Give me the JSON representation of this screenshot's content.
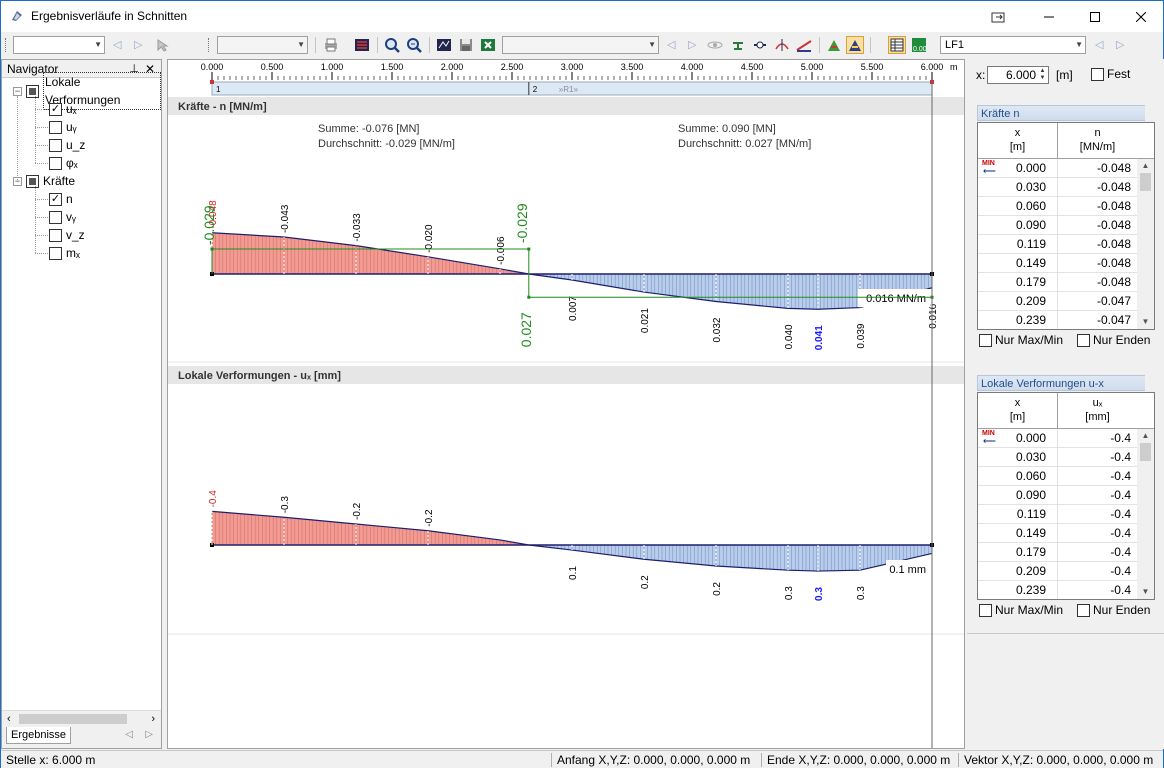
{
  "window": {
    "title": "Ergebnisverläufe in Schnitten"
  },
  "toolbar": {
    "load_case": "LF1"
  },
  "navigator": {
    "title": "Navigator",
    "tab_label": "Ergebnisse",
    "groups": [
      {
        "label": "Lokale Verformungen",
        "items": [
          {
            "label": "uₓ",
            "checked": true
          },
          {
            "label": "uᵧ",
            "checked": false
          },
          {
            "label": "u_z",
            "checked": false
          },
          {
            "label": "φₓ",
            "checked": false
          }
        ]
      },
      {
        "label": "Kräfte",
        "items": [
          {
            "label": "n",
            "checked": true
          },
          {
            "label": "vᵧ",
            "checked": false
          },
          {
            "label": "v_z",
            "checked": false
          },
          {
            "label": "mₓ",
            "checked": false
          }
        ]
      }
    ]
  },
  "ruler": {
    "ticks": [
      "0.000",
      "0.500",
      "1.000",
      "1.500",
      "2.000",
      "2.500",
      "3.000",
      "3.500",
      "4.000",
      "4.500",
      "5.000",
      "5.500",
      "6.000"
    ],
    "unit": "m",
    "segment_labels": [
      "1",
      "2"
    ],
    "segment_name": "»R1»"
  },
  "chart_data": [
    {
      "type": "area",
      "title": "Kräfte - n [MN/m]",
      "x_unit": "m",
      "xlim": [
        0,
        6.0
      ],
      "summary": [
        {
          "sum": "Summe: -0.076 [MN]",
          "avg": "Durchschnitt: -0.029 [MN/m]"
        },
        {
          "sum": "Summe: 0.090 [MN]",
          "avg": "Durchschnitt: 0.027 [MN/m]"
        }
      ],
      "x": [
        0.0,
        0.6,
        1.2,
        1.8,
        2.4,
        2.64,
        3.0,
        3.6,
        4.2,
        4.8,
        5.05,
        5.4,
        6.0
      ],
      "y": [
        -0.048,
        -0.043,
        -0.033,
        -0.02,
        -0.006,
        0.0,
        0.007,
        0.021,
        0.032,
        0.04,
        0.041,
        0.039,
        0.016
      ],
      "point_labels": [
        {
          "x": 0.0,
          "text": "-0.048",
          "color": "#d42020"
        },
        {
          "x": 0.6,
          "text": "-0.043",
          "color": "#000000"
        },
        {
          "x": 1.2,
          "text": "-0.033",
          "color": "#000000"
        },
        {
          "x": 1.8,
          "text": "-0.020",
          "color": "#000000"
        },
        {
          "x": 2.4,
          "text": "-0.006",
          "color": "#000000"
        },
        {
          "x": 3.0,
          "text": "0.007",
          "color": "#000000"
        },
        {
          "x": 3.6,
          "text": "0.021",
          "color": "#000000"
        },
        {
          "x": 4.2,
          "text": "0.032",
          "color": "#000000"
        },
        {
          "x": 4.8,
          "text": "0.040",
          "color": "#000000"
        },
        {
          "x": 5.05,
          "text": "0.041",
          "color": "#1a1aff"
        },
        {
          "x": 5.4,
          "text": "0.039",
          "color": "#000000"
        },
        {
          "x": 6.0,
          "text": "0.016",
          "color": "#000000"
        }
      ],
      "averages": [
        {
          "x_from": 0.0,
          "x_to": 2.64,
          "value": -0.029,
          "text": "-0.029"
        },
        {
          "x_from": 2.64,
          "x_to": 6.0,
          "value": 0.027,
          "text": "0.027"
        }
      ],
      "extra_label": "-0.029",
      "end_label": "0.016 MN/m",
      "colors": {
        "negative": "#f08a80",
        "positive": "#a9c4ea",
        "outline": "#1e1e6e",
        "average": "#1e8c1e"
      }
    },
    {
      "type": "area",
      "title": "Lokale Verformungen - uₓ [mm]",
      "x_unit": "m",
      "xlim": [
        0,
        6.0
      ],
      "x": [
        0.0,
        0.6,
        1.2,
        1.8,
        2.4,
        2.64,
        3.0,
        3.6,
        4.2,
        4.8,
        5.05,
        5.4,
        6.0
      ],
      "y": [
        -0.4,
        -0.33,
        -0.25,
        -0.17,
        -0.06,
        0.0,
        0.06,
        0.17,
        0.25,
        0.3,
        0.31,
        0.3,
        0.1
      ],
      "point_labels": [
        {
          "x": 0.0,
          "text": "-0.4",
          "color": "#d42020"
        },
        {
          "x": 0.6,
          "text": "-0.3",
          "color": "#000000"
        },
        {
          "x": 1.2,
          "text": "-0.2",
          "color": "#000000"
        },
        {
          "x": 1.8,
          "text": "-0.2",
          "color": "#000000"
        },
        {
          "x": 3.0,
          "text": "0.1",
          "color": "#000000"
        },
        {
          "x": 3.6,
          "text": "0.2",
          "color": "#000000"
        },
        {
          "x": 4.2,
          "text": "0.2",
          "color": "#000000"
        },
        {
          "x": 4.8,
          "text": "0.3",
          "color": "#000000"
        },
        {
          "x": 5.05,
          "text": "0.3",
          "color": "#1a1aff"
        },
        {
          "x": 5.4,
          "text": "0.3",
          "color": "#000000"
        }
      ],
      "end_label": "0.1 mm",
      "colors": {
        "negative": "#f08a80",
        "positive": "#a9c4ea",
        "outline": "#1e1e6e"
      }
    }
  ],
  "right_panel": {
    "x_label": "x:",
    "x_value": "6.000",
    "x_unit": "[m]",
    "fixed_label": "Fest",
    "only_maxmin_label": "Nur Max/Min",
    "only_ends_label": "Nur Enden",
    "tables": [
      {
        "title": "Kräfte n",
        "col_x": "x",
        "col_x_unit": "[m]",
        "col_v": "n",
        "col_v_unit": "[MN/m]",
        "rows": [
          [
            "0.000",
            "-0.048"
          ],
          [
            "0.030",
            "-0.048"
          ],
          [
            "0.060",
            "-0.048"
          ],
          [
            "0.090",
            "-0.048"
          ],
          [
            "0.119",
            "-0.048"
          ],
          [
            "0.149",
            "-0.048"
          ],
          [
            "0.179",
            "-0.048"
          ],
          [
            "0.209",
            "-0.047"
          ],
          [
            "0.239",
            "-0.047"
          ]
        ]
      },
      {
        "title": "Lokale Verformungen u-x",
        "col_x": "x",
        "col_x_unit": "[m]",
        "col_v": "uₓ",
        "col_v_unit": "[mm]",
        "rows": [
          [
            "0.000",
            "-0.4"
          ],
          [
            "0.030",
            "-0.4"
          ],
          [
            "0.060",
            "-0.4"
          ],
          [
            "0.090",
            "-0.4"
          ],
          [
            "0.119",
            "-0.4"
          ],
          [
            "0.149",
            "-0.4"
          ],
          [
            "0.179",
            "-0.4"
          ],
          [
            "0.209",
            "-0.4"
          ],
          [
            "0.239",
            "-0.4"
          ]
        ]
      }
    ]
  },
  "statusbar": {
    "position": "Stelle x: 6.000 m",
    "start": "Anfang X,Y,Z:  0.000, 0.000, 0.000 m",
    "end": "Ende X,Y,Z:  0.000, 0.000, 0.000 m",
    "vector": "Vektor X,Y,Z:  0.000, 0.000, 0.000 m"
  }
}
